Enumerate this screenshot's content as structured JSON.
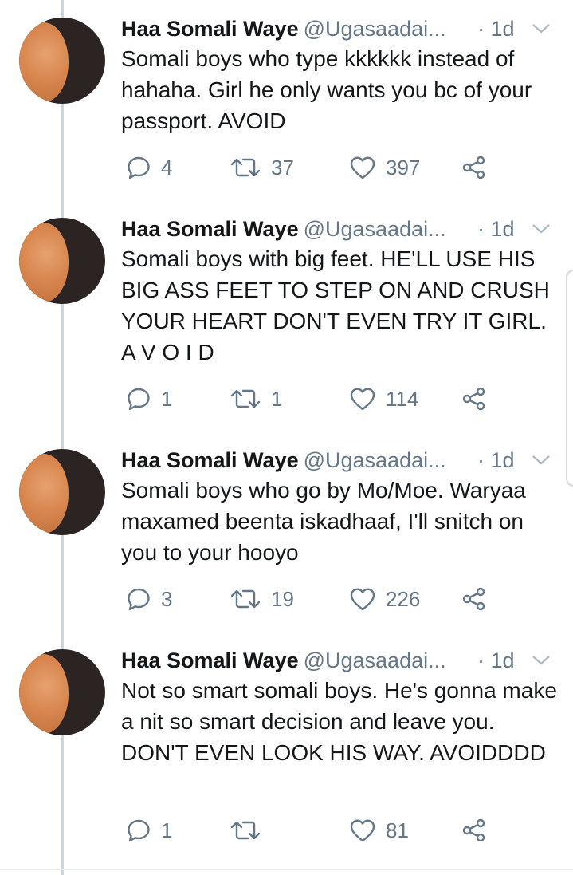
{
  "tweets": [
    {
      "name": "Haa Somali Waye",
      "handle": "@Ugasaadai...",
      "time": "· 1d",
      "text": "Somali boys who type kkkkkk instead of hahaha. Girl he only wants you bc of your passport. AVOID",
      "replies": "4",
      "retweets": "37",
      "likes": "397"
    },
    {
      "name": "Haa Somali Waye",
      "handle": "@Ugasaadai...",
      "time": "· 1d",
      "text": "Somali boys with big feet. HE'LL USE HIS BIG ASS FEET TO STEP ON AND CRUSH YOUR HEART DON'T EVEN TRY IT GIRL. A V O I D",
      "replies": "1",
      "retweets": "1",
      "likes": "114"
    },
    {
      "name": "Haa Somali Waye",
      "handle": "@Ugasaadai...",
      "time": "· 1d",
      "text": "Somali boys who go by Mo/Moe. Waryaa maxamed beenta iskadhaaf, I'll snitch on you to your hooyo",
      "replies": "3",
      "retweets": "19",
      "likes": "226"
    },
    {
      "name": "Haa Somali Waye",
      "handle": "@Ugasaadai...",
      "time": "· 1d",
      "text": "Not so smart somali boys. He's gonna make a nit so smart decision and leave you. DON'T EVEN LOOK HIS WAY. AVOIDDDD",
      "replies": "1",
      "retweets": "",
      "likes": "81"
    }
  ],
  "icons": {
    "reply": "reply-icon",
    "retweet": "retweet-icon",
    "like": "heart-icon",
    "share": "share-icon",
    "more": "chevron-down-icon"
  },
  "colors": {
    "icon_gray": "#657786",
    "text": "#14171a",
    "thread_line": "#ccd6dd"
  }
}
